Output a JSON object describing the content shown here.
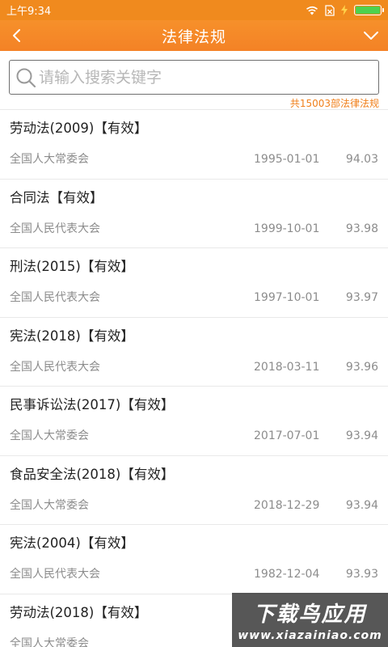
{
  "status_bar": {
    "time": "上午9:34"
  },
  "header": {
    "title": "法律法规"
  },
  "search": {
    "placeholder": "请输入搜索关键字",
    "value": ""
  },
  "summary": {
    "count_text": "共15003部法律法规"
  },
  "items": [
    {
      "title": "劳动法(2009)【有效】",
      "org": "全国人大常委会",
      "date": "1995-01-01",
      "score": "94.03"
    },
    {
      "title": "合同法【有效】",
      "org": "全国人民代表大会",
      "date": "1999-10-01",
      "score": "93.98"
    },
    {
      "title": "刑法(2015)【有效】",
      "org": "全国人民代表大会",
      "date": "1997-10-01",
      "score": "93.97"
    },
    {
      "title": "宪法(2018)【有效】",
      "org": "全国人民代表大会",
      "date": "2018-03-11",
      "score": "93.96"
    },
    {
      "title": "民事诉讼法(2017)【有效】",
      "org": "全国人大常委会",
      "date": "2017-07-01",
      "score": "93.94"
    },
    {
      "title": "食品安全法(2018)【有效】",
      "org": "全国人大常委会",
      "date": "2018-12-29",
      "score": "93.94"
    },
    {
      "title": "宪法(2004)【有效】",
      "org": "全国人民代表大会",
      "date": "1982-12-04",
      "score": "93.93"
    },
    {
      "title": "劳动法(2018)【有效】",
      "org": "全国人大常委会",
      "date": "",
      "score": ""
    }
  ],
  "watermark": {
    "line1": "下载鸟应用",
    "line2": "www.xiazainiao.com"
  },
  "colors": {
    "accent": "#f48226",
    "count_text": "#f07f1a",
    "battery": "#4ed14e"
  },
  "icons": [
    "wifi-icon",
    "sim-icon",
    "charging-icon",
    "battery-icon",
    "back-arrow-icon",
    "menu-chevron-icon",
    "search-icon"
  ]
}
